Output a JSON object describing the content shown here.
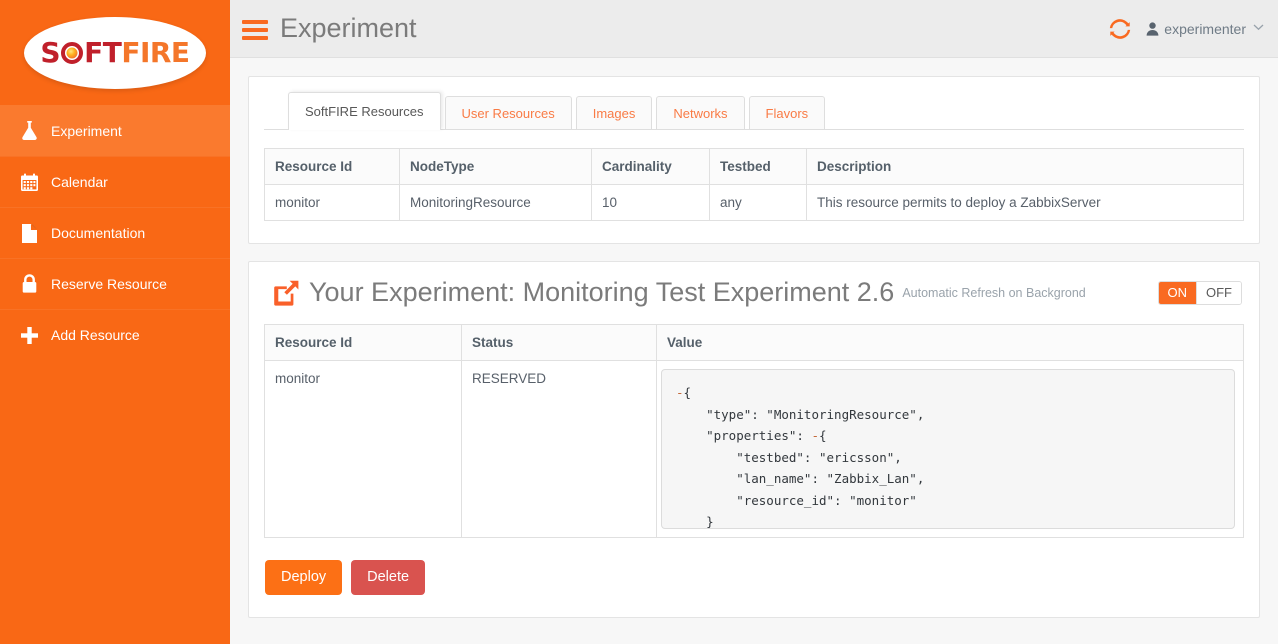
{
  "brand": {
    "logo_soft": "S",
    "logo_soft_rest": "FT",
    "logo_fire": "FIRE",
    "accent_orange": "#f96815",
    "accent_orange_light": "#fa7a2e",
    "logo_dark_red": "#c0202b",
    "logo_orange": "#f4762a"
  },
  "sidebar": {
    "items": [
      {
        "label": "Experiment",
        "icon": "flask-icon",
        "active": true
      },
      {
        "label": "Calendar",
        "icon": "calendar-icon",
        "active": false
      },
      {
        "label": "Documentation",
        "icon": "document-icon",
        "active": false
      },
      {
        "label": "Reserve Resource",
        "icon": "lock-icon",
        "active": false
      },
      {
        "label": "Add Resource",
        "icon": "plus-icon",
        "active": false
      }
    ]
  },
  "topbar": {
    "menu_icon": "hamburger-icon",
    "title": "Experiment",
    "refresh_icon": "refresh-icon",
    "user_icon": "user-icon",
    "username": "experimenter",
    "caret": "⌄"
  },
  "tabs": [
    {
      "label": "SoftFIRE Resources",
      "active": true
    },
    {
      "label": "User Resources",
      "active": false
    },
    {
      "label": "Images",
      "active": false
    },
    {
      "label": "Networks",
      "active": false
    },
    {
      "label": "Flavors",
      "active": false
    }
  ],
  "resources_table": {
    "headers": [
      "Resource Id",
      "NodeType",
      "Cardinality",
      "Testbed",
      "Description"
    ],
    "rows": [
      [
        "monitor",
        "MonitoringResource",
        "10",
        "any",
        "This resource permits to deploy a ZabbixServer"
      ]
    ]
  },
  "experiment": {
    "external_link_icon": "external-link-icon",
    "title": "Your Experiment: Monitoring Test Experiment 2.6",
    "auto_refresh_label": "Automatic Refresh on Backgrond",
    "toggle_on": "ON",
    "toggle_off": "OFF",
    "toggle_state": "ON"
  },
  "experiment_table": {
    "headers": [
      "Resource Id",
      "Status",
      "Value"
    ],
    "rows": [
      {
        "resource_id": "monitor",
        "status": "RESERVED",
        "value": "-{\n    \"type\": \"MonitoringResource\",\n    \"properties\": -{\n        \"testbed\": \"ericsson\",\n        \"lan_name\": \"Zabbix_Lan\",\n        \"resource_id\": \"monitor\"\n    }\n}"
      }
    ]
  },
  "actions": {
    "deploy_label": "Deploy",
    "deploy_color": "#fc7015",
    "delete_label": "Delete",
    "delete_color": "#d9534f"
  }
}
